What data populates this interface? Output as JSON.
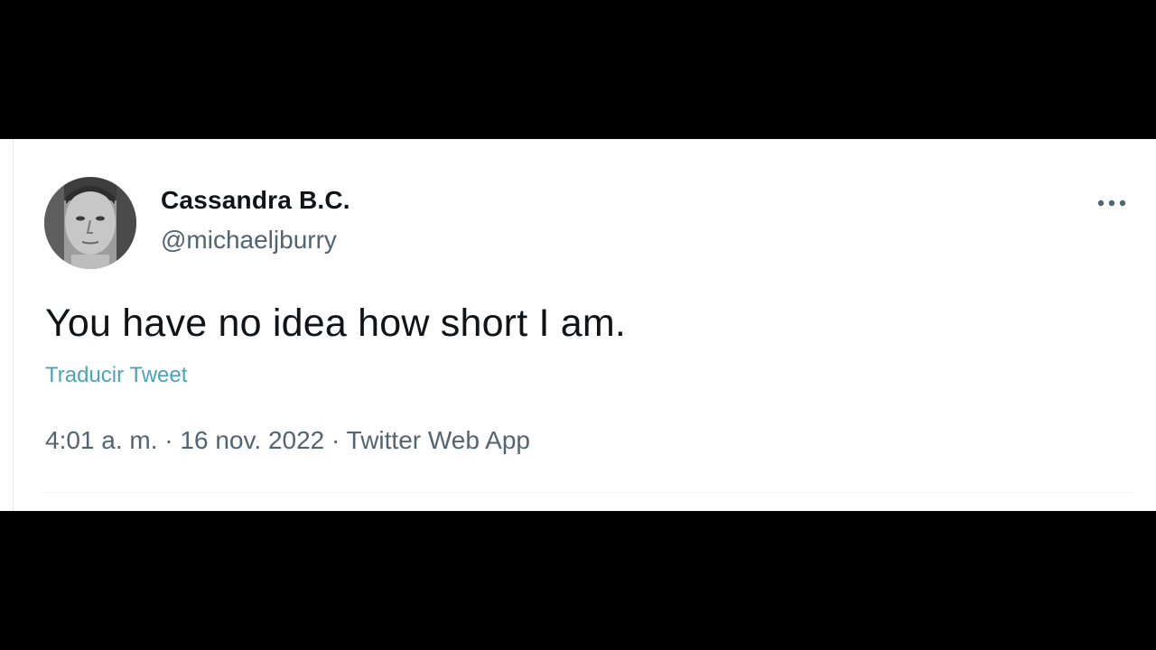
{
  "tweet": {
    "author": {
      "display_name": "Cassandra B.C.",
      "handle": "@michaeljburry",
      "avatar_icon": "profile-photo-avatar"
    },
    "text": "You have no idea how short I am.",
    "translate_label": "Traducir Tweet",
    "time": "4:01 a. m.",
    "separator": " · ",
    "date": "16 nov. 2022",
    "source": "Twitter Web App",
    "more_icon": "more-options-icon"
  },
  "colors": {
    "background_letterbox": "#000000",
    "card": "#ffffff",
    "primary_text": "#0f1419",
    "secondary_text": "#536471",
    "link": "#4aa3b8"
  }
}
